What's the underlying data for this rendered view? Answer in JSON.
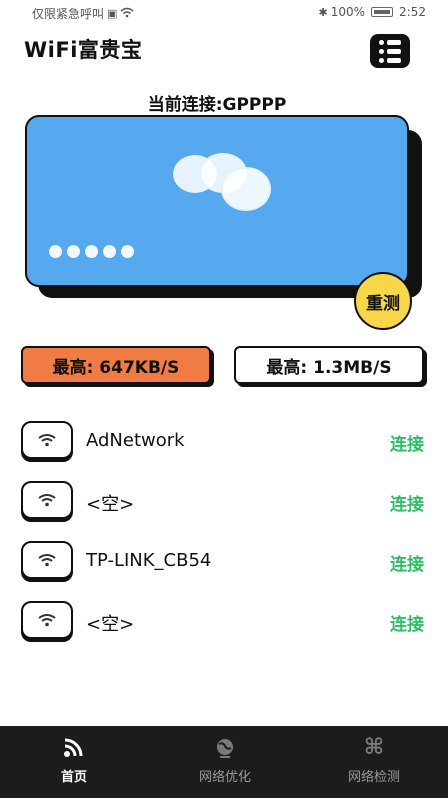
{
  "status_bar": {
    "carrier_text": "仅限紧急呼叫",
    "battery_text": "100%",
    "time": "2:52"
  },
  "header": {
    "app_title": "WiFi富贵宝",
    "menu_icon": "grid-list-icon"
  },
  "connection": {
    "label": "当前连接:GPPPP"
  },
  "speed_card": {
    "retest_label": "重测",
    "card_color": "#57a9ef",
    "retest_color": "#f7d64a"
  },
  "speeds": [
    {
      "label": "最高: 647KB/S",
      "color": "#f07b43"
    },
    {
      "label": "最高: 1.3MB/S",
      "color": "#ffffff"
    }
  ],
  "wifi_list": [
    {
      "name": "AdNetwork",
      "action": "连接"
    },
    {
      "name": "<空>",
      "action": "连接"
    },
    {
      "name": "TP-LINK_CB54",
      "action": "连接"
    },
    {
      "name": "<空>",
      "action": "连接"
    }
  ],
  "accent_color": "#2dbf63",
  "tabbar": {
    "tabs": [
      {
        "label": "首页",
        "icon": "wifi-icon",
        "active": true
      },
      {
        "label": "网络优化",
        "icon": "globe-icon",
        "active": false
      },
      {
        "label": "网络检测",
        "icon": "command-icon",
        "active": false
      }
    ]
  }
}
